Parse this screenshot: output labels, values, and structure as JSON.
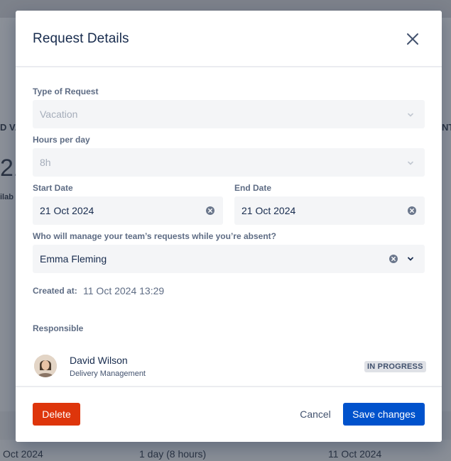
{
  "background": {
    "col_header_left": "D VA",
    "col_header_right": "NT",
    "big_value": "21",
    "small_label": "ilab",
    "row": {
      "start": "Oct 2024",
      "duration": "1 day (8 hours)",
      "end": "11 Oct 2024"
    }
  },
  "modal": {
    "title": "Request Details",
    "fields": {
      "type_label": "Type of Request",
      "type_value": "Vacation",
      "hours_label": "Hours per day",
      "hours_value": "8h",
      "start_label": "Start Date",
      "start_value": "21 Oct 2024",
      "end_label": "End Date",
      "end_value": "21 Oct 2024",
      "manager_label": "Who will manage your team’s requests while you’re absent?",
      "manager_value": "Emma Fleming",
      "created_label": "Created at:",
      "created_value": "11 Oct 2024 13:29"
    },
    "responsible": {
      "label": "Responsible",
      "name": "David Wilson",
      "role": "Delivery Management",
      "status": "IN PROGRESS"
    },
    "footer": {
      "delete_label": "Delete",
      "cancel_label": "Cancel",
      "save_label": "Save changes"
    }
  },
  "colors": {
    "primary": "#0052cc",
    "danger": "#de350b",
    "text": "#172b4d",
    "muted": "#5e6c84",
    "field_bg": "#f4f5f7"
  }
}
